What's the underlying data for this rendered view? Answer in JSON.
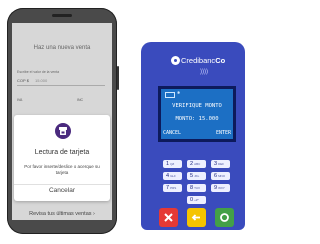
{
  "phone": {
    "screen_title": "Haz una nueva venta",
    "amount_label": "Escribe el valor de la venta",
    "currency": "COP $",
    "amount_placeholder": "15.000",
    "col_left": "IVA",
    "col_right": "INC",
    "dialog": {
      "title": "Lectura de tarjeta",
      "message": "Por favor inserte/deslice o acerque su tarjeta",
      "cancel_label": "Cancelar"
    },
    "review_link": "Revisa tus últimas ventas ›"
  },
  "pos": {
    "brand_light": "Credibanc",
    "brand_bold": "Co",
    "nfc_symbol": "))))",
    "screen": {
      "line1": "VERIFIQUE MONTO",
      "line2": "MONTO: 15.000",
      "soft_left": "CANCEL",
      "soft_right": "ENTER",
      "bluetooth_symbol": "✱"
    },
    "keys": [
      {
        "num": "1",
        "sub": "QZ"
      },
      {
        "num": "2",
        "sub": "ABC"
      },
      {
        "num": "3",
        "sub": "DEF"
      },
      {
        "num": "4",
        "sub": "GHI"
      },
      {
        "num": "5",
        "sub": "JKL"
      },
      {
        "num": "6",
        "sub": "MNO"
      },
      {
        "num": "7",
        "sub": "PRS"
      },
      {
        "num": "8",
        "sub": "TUV"
      },
      {
        "num": "9",
        "sub": "WXY"
      },
      {
        "num": "0",
        "sub": "+#*"
      }
    ],
    "function_keys": {
      "cancel_color": "#e53935",
      "clear_color": "#f5c400",
      "enter_color": "#43a047"
    }
  },
  "colors": {
    "pos_body": "#3a4bbd",
    "pos_screen": "#1c6fc4",
    "dialog_icon": "#4a2a7e"
  }
}
